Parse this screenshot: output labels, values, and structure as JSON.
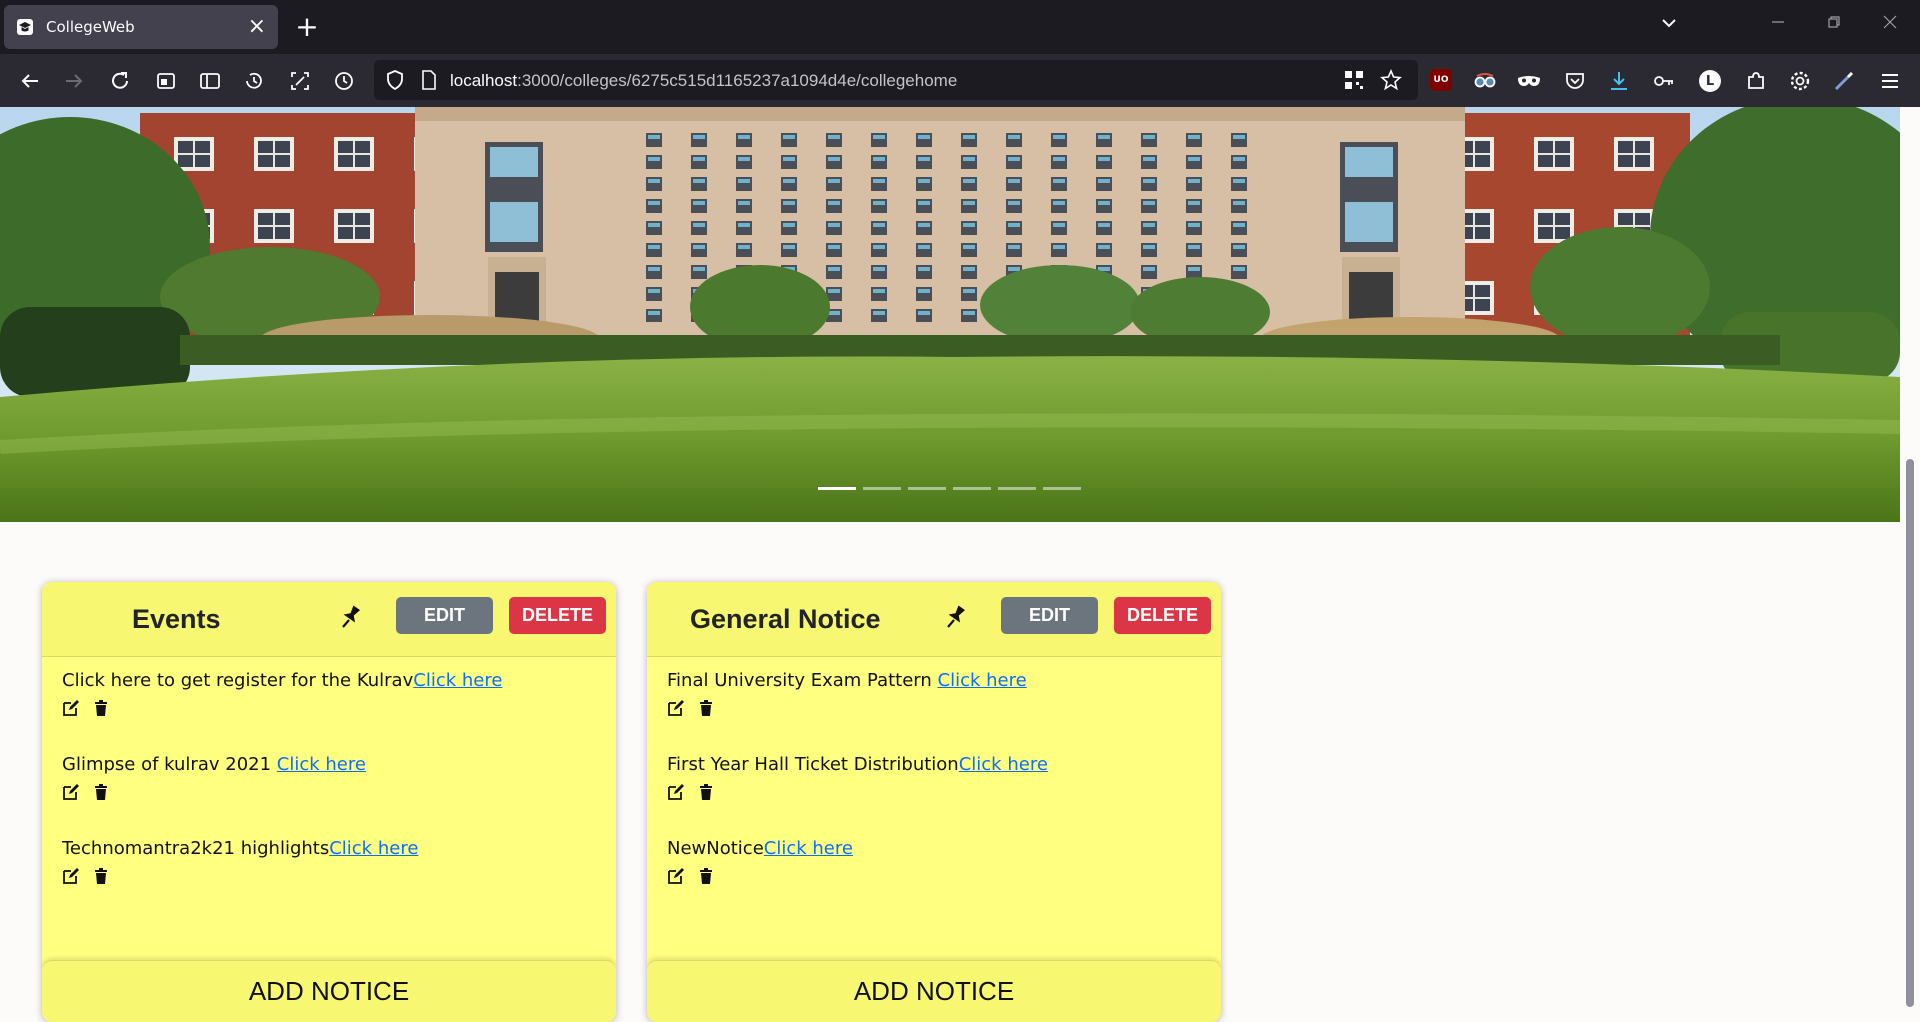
{
  "browser": {
    "tab_title": "CollegeWeb",
    "url_host": "localhost",
    "url_rest": ":3000/colleges/6275c515d1165237a1094d4e/collegehome",
    "extension_avatar_letter": "L",
    "ublock_badge": "UO"
  },
  "hero": {
    "slide_count": 6,
    "active_slide": 1
  },
  "cards": [
    {
      "title": "Events",
      "edit_label": "EDIT",
      "delete_label": "DELETE",
      "notices": [
        {
          "text": "Click here to get register for the Kulrav",
          "link": "Click here"
        },
        {
          "text": "Glimpse of kulrav 2021 ",
          "link": "Click here"
        },
        {
          "text": "Technomantra2k21 highlights",
          "link": "Click here"
        }
      ],
      "add_label": "ADD NOTICE"
    },
    {
      "title": "General Notice",
      "edit_label": "EDIT",
      "delete_label": "DELETE",
      "notices": [
        {
          "text": "Final University Exam Pattern ",
          "link": "Click here"
        },
        {
          "text": "First Year Hall Ticket Distribution",
          "link": "Click here"
        },
        {
          "text": "NewNotice",
          "link": "Click here"
        }
      ],
      "add_label": "ADD NOTICE"
    }
  ],
  "colors": {
    "card_bg": "#ffff80",
    "edit_btn": "#6c757d",
    "delete_btn": "#dc3545",
    "link": "#0d6efd"
  }
}
